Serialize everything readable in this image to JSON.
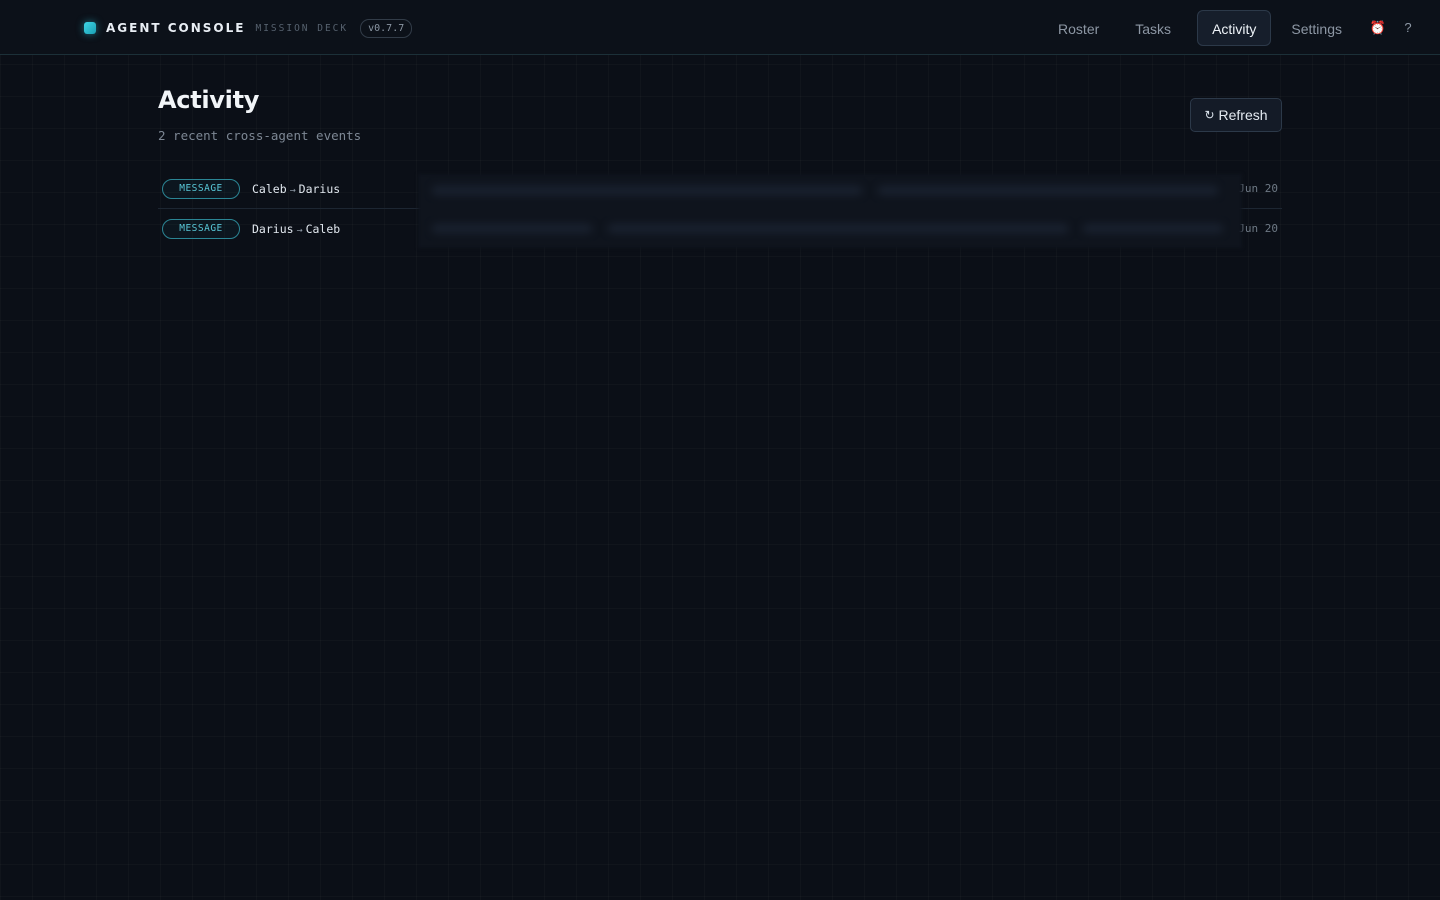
{
  "app": {
    "title": "AGENT CONSOLE",
    "subtitle": "MISSION DECK",
    "version": "v0.7.7"
  },
  "nav": {
    "items": [
      {
        "label": "Roster",
        "active": false
      },
      {
        "label": "Tasks",
        "active": false
      },
      {
        "label": "Activity",
        "active": true
      },
      {
        "label": "Settings",
        "active": false
      }
    ],
    "alarm_icon": "⏰",
    "help_label": "?"
  },
  "page": {
    "title": "Activity",
    "subtitle": "2 recent cross-agent events",
    "refresh_label": "Refresh",
    "refresh_icon": "↻"
  },
  "events": [
    {
      "type": "MESSAGE",
      "from": "Caleb",
      "to": "Darius",
      "arrow": "→",
      "date": "Jun 20"
    },
    {
      "type": "MESSAGE",
      "from": "Darius",
      "to": "Caleb",
      "arrow": "→",
      "date": "Jun 20"
    }
  ],
  "colors": {
    "background": "#0b0f17",
    "accent": "#3fd6e6",
    "badge_text": "#58c6d6",
    "badge_border": "#2b8594"
  },
  "icons": {
    "brand": "brand-logo-icon",
    "alarm": "alarm-clock-icon",
    "help": "help-icon",
    "refresh": "refresh-icon",
    "arrow": "arrow-right-icon"
  }
}
